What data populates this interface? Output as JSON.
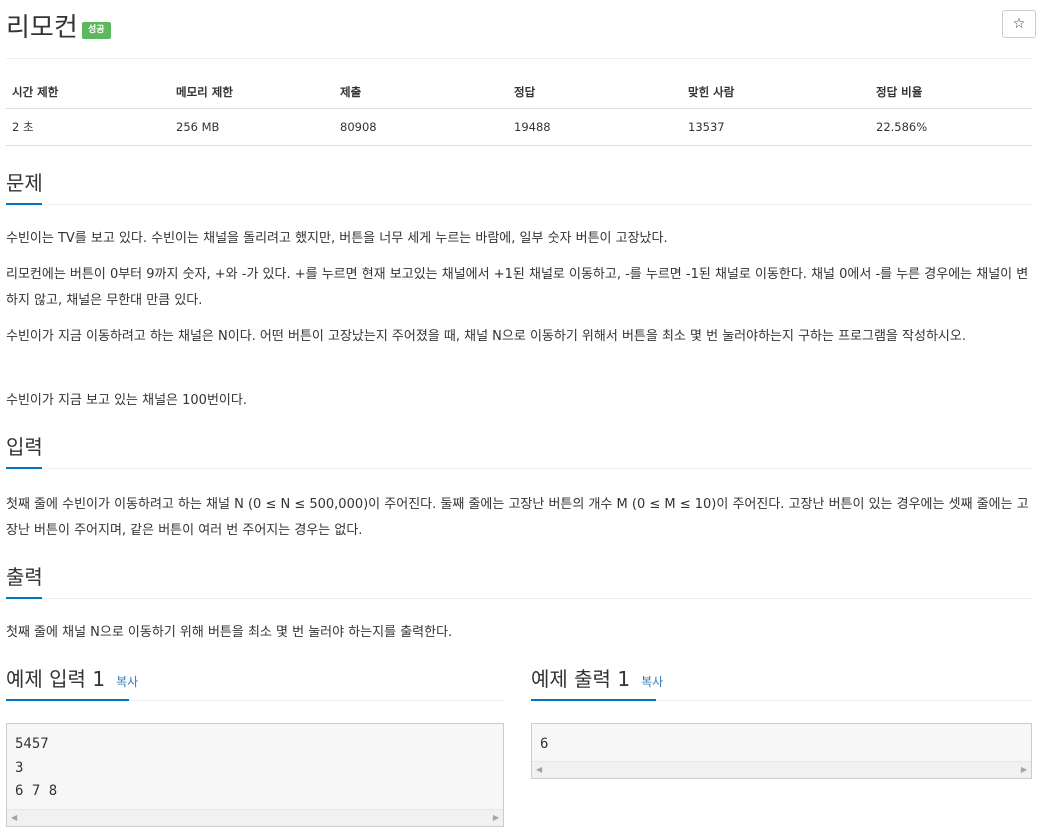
{
  "problem": {
    "title": "리모컨",
    "badge": "성공",
    "star_icon": "☆"
  },
  "info_table": {
    "headers": [
      "시간 제한",
      "메모리 제한",
      "제출",
      "정답",
      "맞힌 사람",
      "정답 비율"
    ],
    "values": [
      "2 초",
      "256 MB",
      "80908",
      "19488",
      "13537",
      "22.586%"
    ]
  },
  "sections": {
    "description": {
      "heading": "문제",
      "paragraphs": [
        "수빈이는 TV를 보고 있다. 수빈이는 채널을 돌리려고 했지만, 버튼을 너무 세게 누르는 바람에, 일부 숫자 버튼이 고장났다.",
        "리모컨에는 버튼이 0부터 9까지 숫자, +와 -가 있다. +를 누르면 현재 보고있는 채널에서 +1된 채널로 이동하고, -를 누르면 -1된 채널로 이동한다. 채널 0에서 -를 누른 경우에는 채널이 변하지 않고, 채널은 무한대 만큼 있다.",
        "수빈이가 지금 이동하려고 하는 채널은 N이다. 어떤 버튼이 고장났는지 주어졌을 때, 채널 N으로 이동하기 위해서 버튼을 최소 몇 번 눌러야하는지 구하는 프로그램을 작성하시오.",
        "수빈이가 지금 보고 있는 채널은 100번이다."
      ]
    },
    "input": {
      "heading": "입력",
      "paragraph": "첫째 줄에 수빈이가 이동하려고 하는 채널 N (0 ≤ N ≤ 500,000)이 주어진다.  둘째 줄에는 고장난 버튼의 개수 M (0 ≤ M ≤ 10)이 주어진다. 고장난 버튼이 있는 경우에는 셋째 줄에는 고장난 버튼이 주어지며, 같은 버튼이 여러 번 주어지는 경우는 없다."
    },
    "output": {
      "heading": "출력",
      "paragraph": "첫째 줄에 채널 N으로 이동하기 위해 버튼을 최소 몇 번 눌러야 하는지를 출력한다."
    }
  },
  "samples": {
    "input": {
      "heading": "예제 입력 1",
      "copy_label": "복사",
      "content": "5457\n3\n6 7 8"
    },
    "output": {
      "heading": "예제 출력 1",
      "copy_label": "복사",
      "content": "6"
    }
  },
  "scroll_arrows": {
    "left": "◀",
    "right": "▶"
  },
  "colors": {
    "success_badge": "#5cb85c",
    "heading_underline": "#0076c0",
    "link": "#337ab7"
  }
}
